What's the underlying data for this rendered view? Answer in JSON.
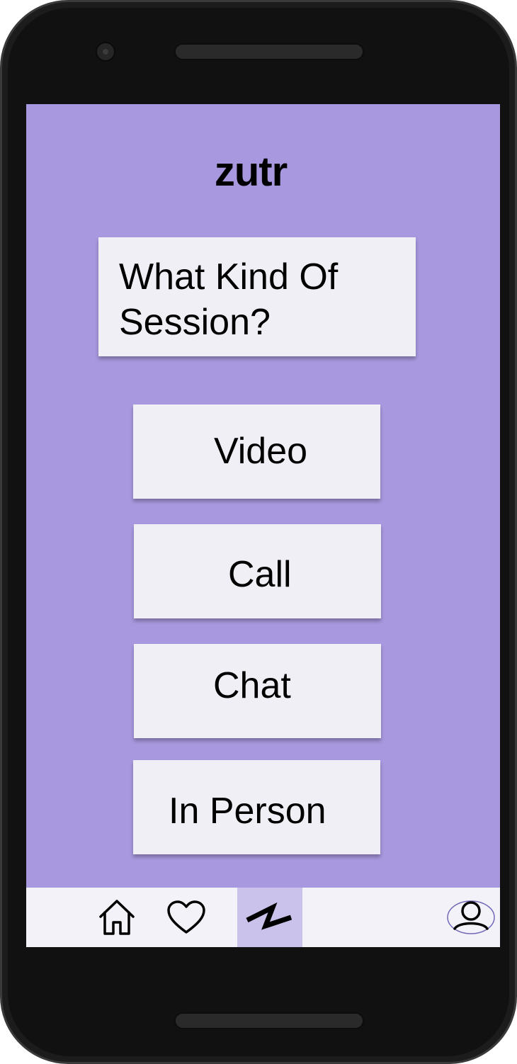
{
  "app": {
    "title": "zutr"
  },
  "question": {
    "text": "What Kind Of Session?"
  },
  "options": [
    {
      "label": "Video"
    },
    {
      "label": "Call"
    },
    {
      "label": "Chat"
    },
    {
      "label": "In Person"
    }
  ],
  "bottom_nav": {
    "items": [
      {
        "icon": "home-icon"
      },
      {
        "icon": "heart-icon"
      },
      {
        "icon": "zutr-logo-icon",
        "active": true
      },
      {
        "icon": "profile-icon"
      }
    ],
    "active_color": "#cbc2ec",
    "background": "#f3f2f8"
  },
  "colors": {
    "screen_background": "#a898df",
    "card_background": "#f0eff5",
    "text": "#000000"
  }
}
